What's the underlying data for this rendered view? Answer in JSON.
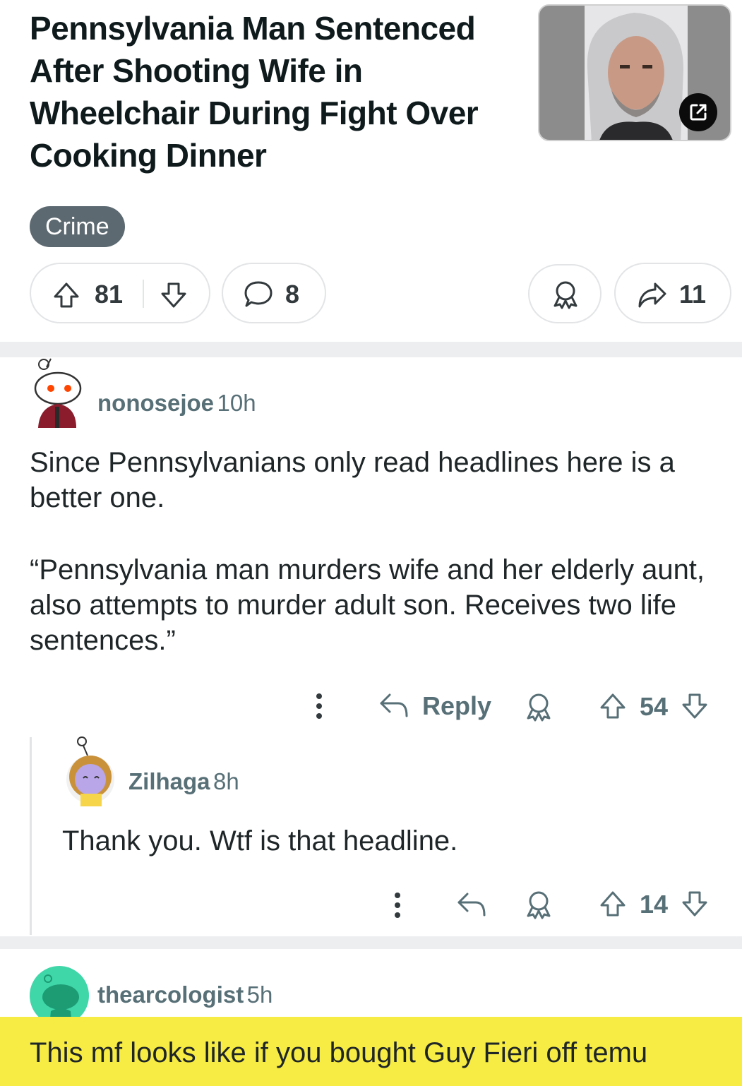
{
  "post": {
    "title": "Pennsylvania Man Sentenced After Shooting Wife in Wheelchair During Fight Over Cooking Dinner",
    "flair": "Crime",
    "score": "81",
    "comments": "8",
    "shares": "11"
  },
  "comments": [
    {
      "username": "nonosejoe",
      "age": "10h",
      "paragraphs": [
        "Since Pennsylvanians only read headlines here is a better one.",
        "“Pennsylvania man murders wife and her elderly aunt, also attempts to murder adult son. Receives two life sentences.”"
      ],
      "reply_label": "Reply",
      "score": "54"
    },
    {
      "username": "Zilhaga",
      "age": "8h",
      "text": "Thank you. Wtf is that headline.",
      "score": "14"
    },
    {
      "username": "thearcologist",
      "age": "5h",
      "text": "This mf looks like if you bought Guy Fieri off temu"
    }
  ],
  "colors": {
    "highlight": "#f7ec43",
    "flair_bg": "#5c6970",
    "meta_text": "#576f76",
    "divider": "#eceef0"
  },
  "icons": [
    "external-link-icon",
    "upvote-icon",
    "downvote-icon",
    "comment-icon",
    "award-icon",
    "share-icon",
    "more-icon",
    "reply-icon"
  ]
}
